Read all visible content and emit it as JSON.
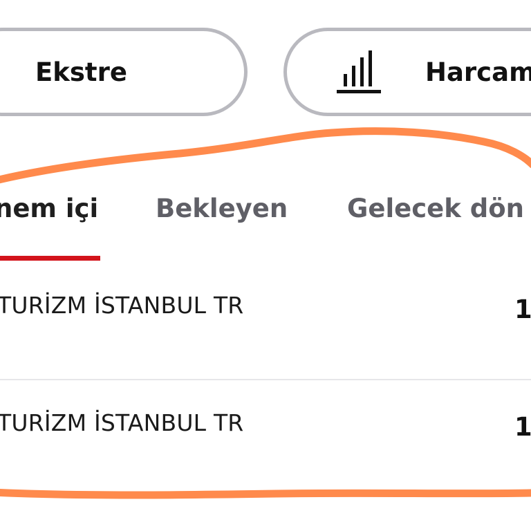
{
  "buttons": {
    "statement_label": "Ekstre",
    "spending_label": "Harcam",
    "spending_icon": "bar-chart-icon"
  },
  "tabs": [
    {
      "label": "nem içi",
      "active": true
    },
    {
      "label": "Bekleyen",
      "active": false
    },
    {
      "label": "Gelecek dön",
      "active": false
    }
  ],
  "transactions": [
    {
      "merchant": "TURİZM İSTANBUL TR",
      "amount": "1"
    },
    {
      "merchant": "TURİZM İSTANBUL TR",
      "amount": "1"
    }
  ],
  "colors": {
    "accent_underline": "#d3141b",
    "annotation_marker": "#ff8a4c",
    "pill_border": "#b9b9bf"
  }
}
